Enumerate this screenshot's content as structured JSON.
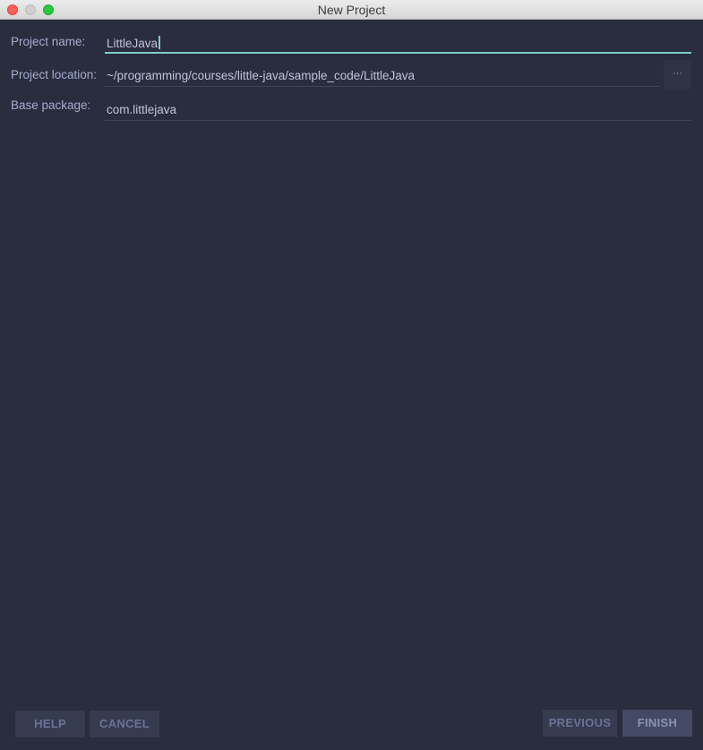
{
  "window": {
    "title": "New Project"
  },
  "form": {
    "project_name": {
      "label": "Project name:",
      "value": "LittleJava"
    },
    "project_location": {
      "label": "Project location:",
      "value": "~/programming/courses/little-java/sample_code/LittleJava",
      "browse_label": "···"
    },
    "base_package": {
      "label": "Base package:",
      "value": "com.littlejava"
    }
  },
  "buttons": {
    "help": "HELP",
    "cancel": "CANCEL",
    "previous": "PREVIOUS",
    "finish": "FINISH"
  },
  "colors": {
    "background": "#292d3e",
    "accent": "#80cbc4",
    "label": "#a6accd"
  }
}
